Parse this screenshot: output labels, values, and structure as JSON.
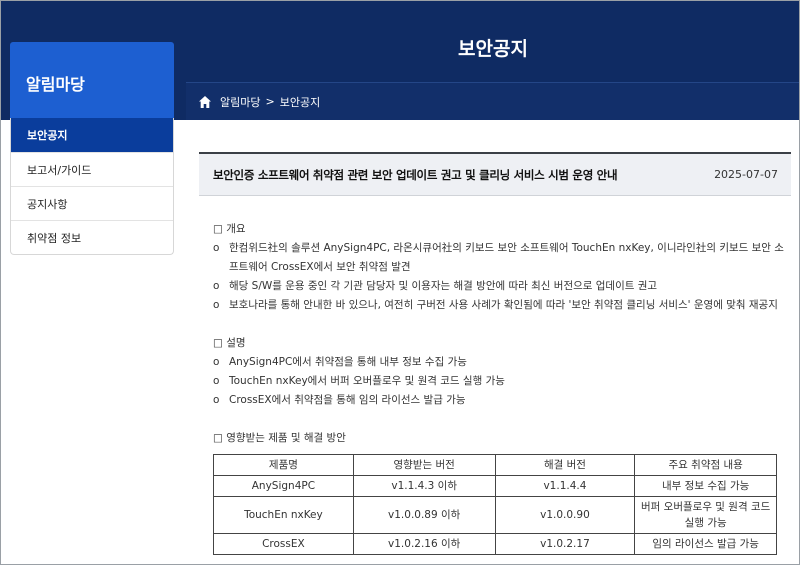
{
  "banner": {
    "title": "보안공지"
  },
  "breadcrumb": {
    "items": [
      "알림마당",
      "보안공지"
    ],
    "separator": ">"
  },
  "sidebar": {
    "title": "알림마당",
    "items": [
      {
        "label": "보안공지",
        "active": true
      },
      {
        "label": "보고서/가이드",
        "active": false
      },
      {
        "label": "공지사항",
        "active": false
      },
      {
        "label": "취약점 정보",
        "active": false
      }
    ]
  },
  "post": {
    "title": "보안인증 소프트웨어 취약점 관련 보안 업데이트 권고 및 클리닝 서비스 시범 운영 안내",
    "date": "2025-07-07"
  },
  "sections": {
    "overview": {
      "heading": "□ 개요",
      "bullets": [
        "한컴위드社의 솔루션 AnySign4PC, 라온시큐어社의 키보드 보안 소프트웨어 TouchEn nxKey, 이니라인社의 키보드 보안 소프트웨어 CrossEX에서 보안 취약점 발견",
        "해당 S/W를 운용 중인 각 기관 담당자 및 이용자는 해결 방안에 따라 최신 버전으로 업데이트 권고",
        "보호나라를 통해 안내한 바 있으나, 여전히 구버전 사용 사례가 확인됨에 따라 '보안 취약점 클리닝 서비스' 운영에 맞춰 재공지"
      ]
    },
    "description": {
      "heading": "□ 설명",
      "bullets": [
        "AnySign4PC에서 취약점을 통해 내부 정보 수집 가능",
        "TouchEn nxKey에서 버퍼 오버플로우 및 원격 코드 실행 가능",
        "CrossEX에서 취약점을 통해 임의 라이선스 발급 가능"
      ]
    },
    "affected": {
      "heading": "□ 영향받는 제품 및 해결 방안"
    }
  },
  "bullet_mark": "o",
  "table": {
    "headers": [
      "제품명",
      "영향받는 버전",
      "해결 버전",
      "주요 취약점 내용"
    ],
    "rows": [
      [
        "AnySign4PC",
        "v1.1.4.3 이하",
        "v1.1.4.4",
        "내부 정보 수집 가능"
      ],
      [
        "TouchEn nxKey",
        "v1.0.0.89 이하",
        "v1.0.0.90",
        "버퍼 오버플로우 및 원격 코드 실행 가능"
      ],
      [
        "CrossEX",
        "v1.0.2.16 이하",
        "v1.0.2.17",
        "임의 라이선스 발급 가능"
      ]
    ]
  },
  "colors": {
    "banner": "#0f2b63",
    "sidebar_head": "#1d5fd1",
    "sidebar_active": "#0a3d9c"
  }
}
